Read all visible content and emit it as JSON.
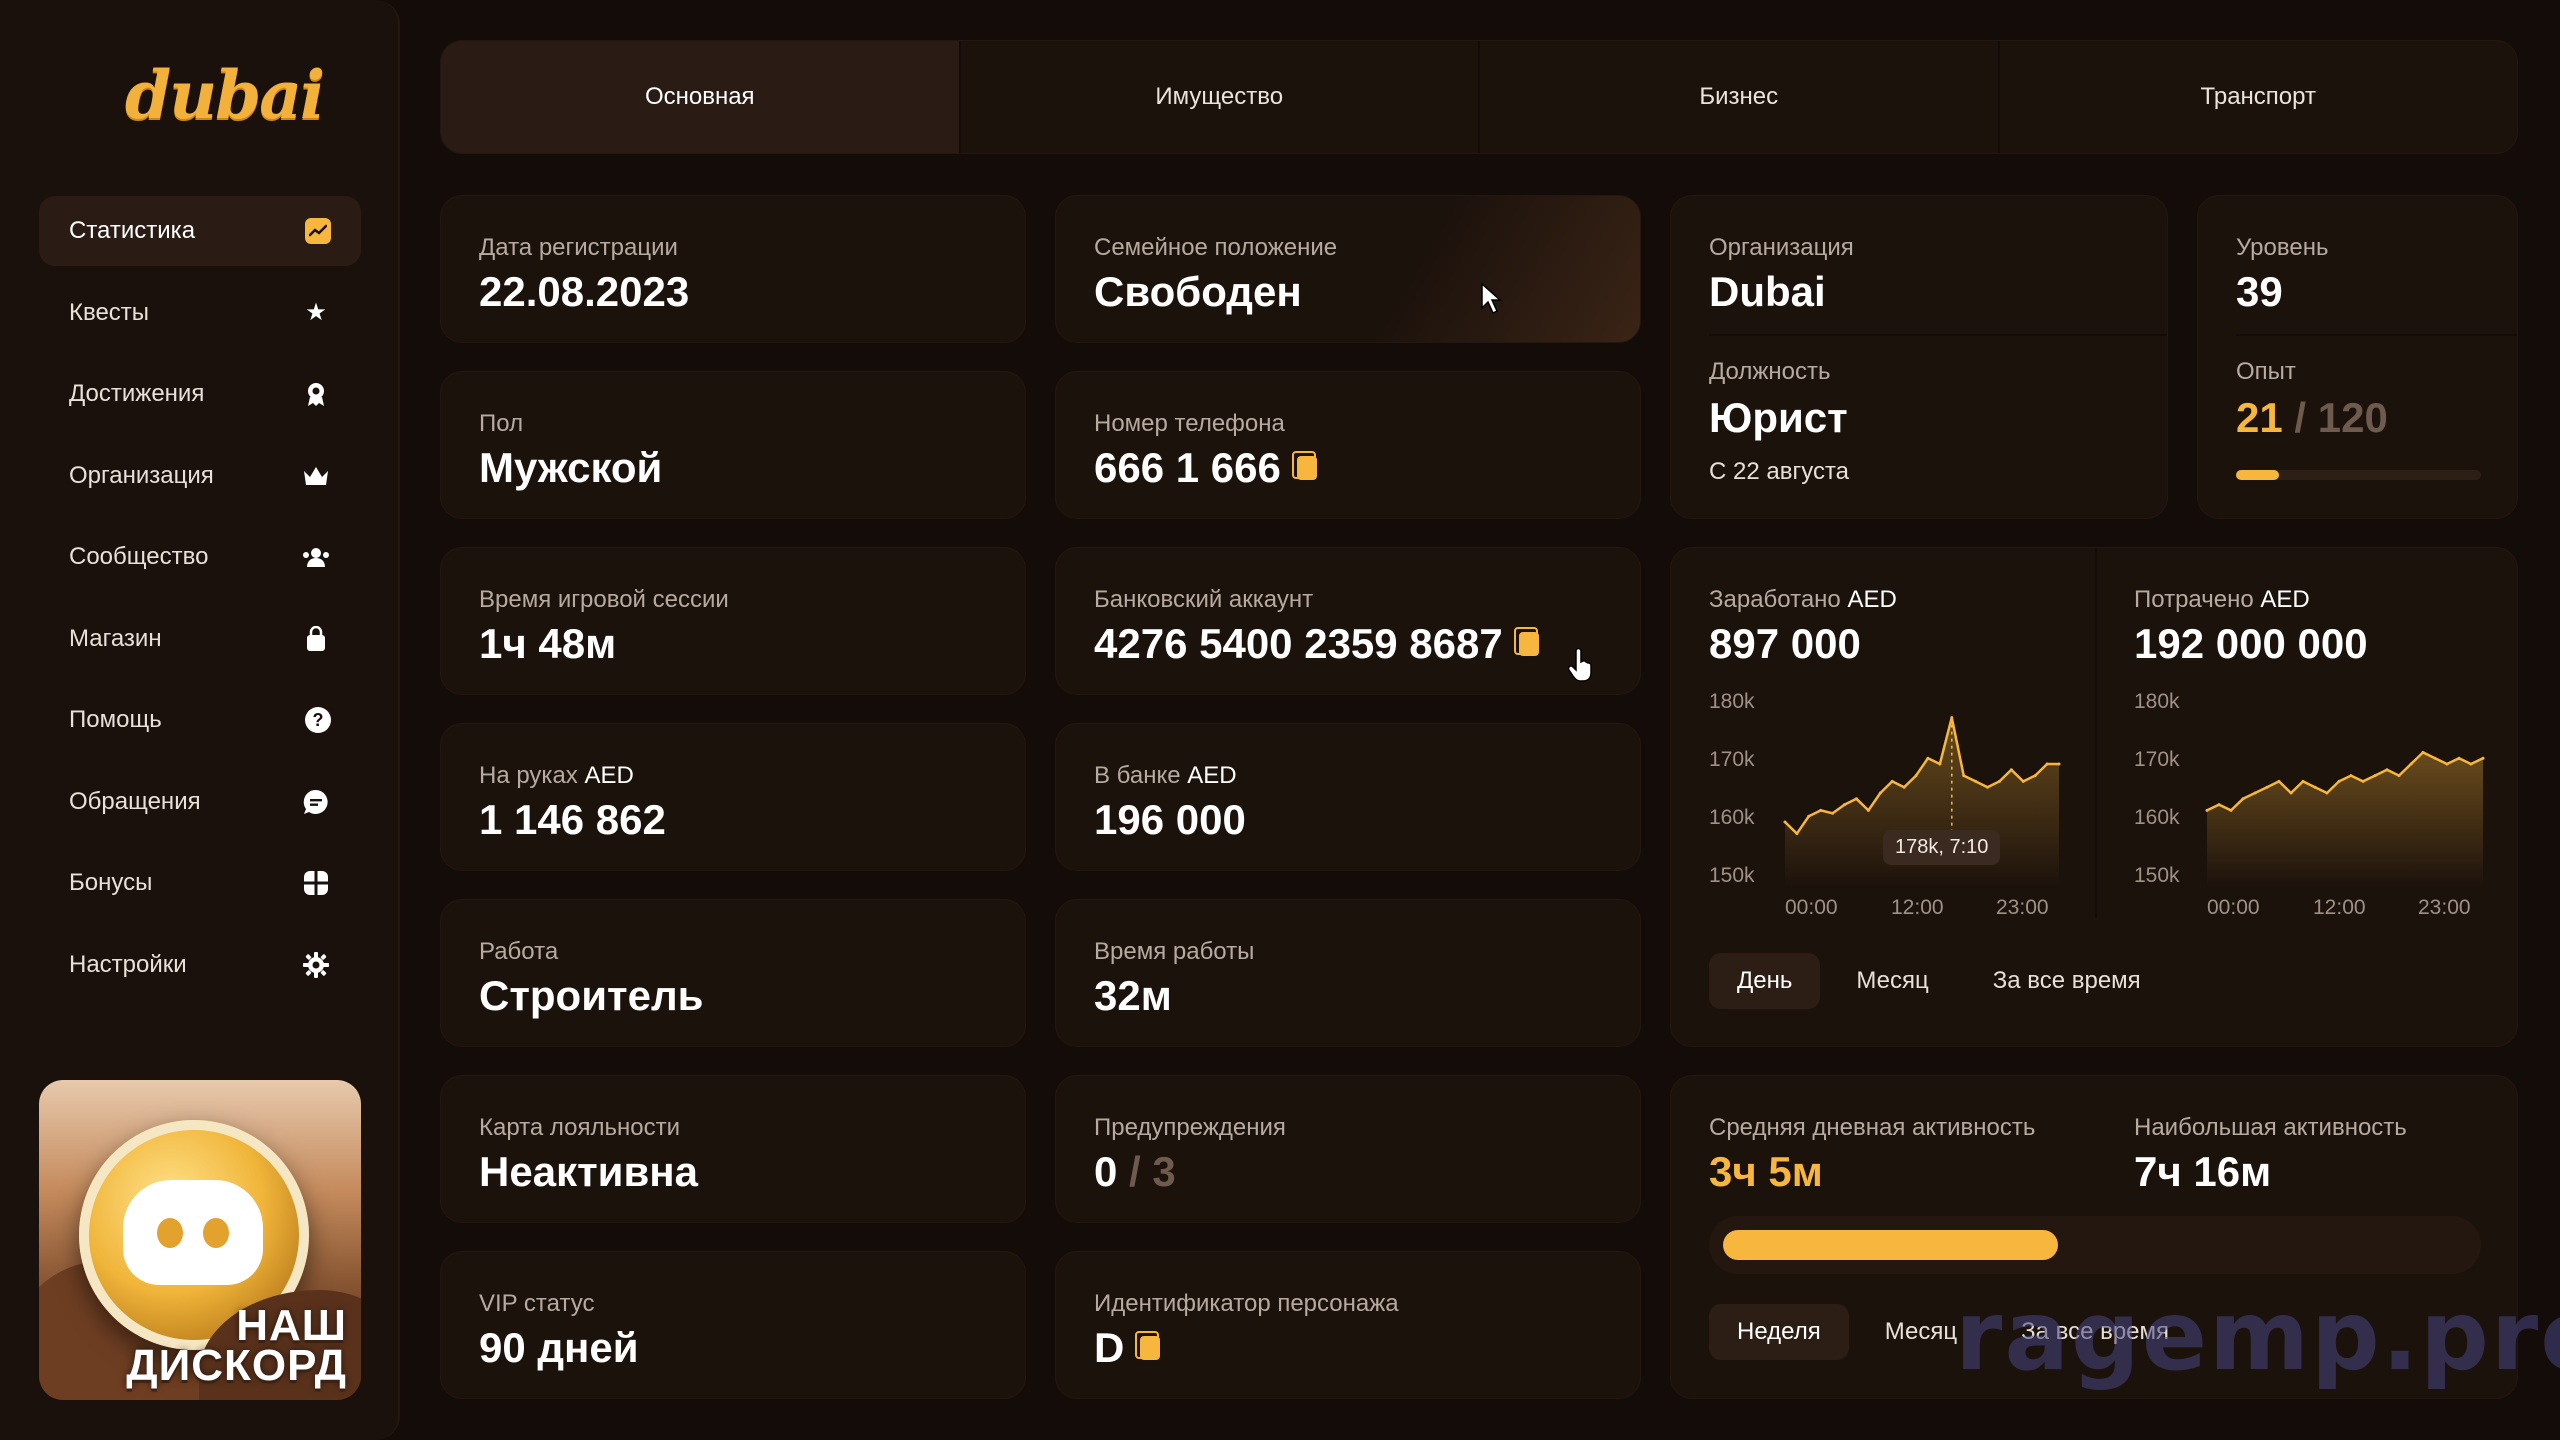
{
  "brand": "dubai",
  "sidebar": {
    "items": [
      {
        "label": "Статистика",
        "icon": "chart-icon"
      },
      {
        "label": "Квесты",
        "icon": "star-icon"
      },
      {
        "label": "Достижения",
        "icon": "award-icon"
      },
      {
        "label": "Организация",
        "icon": "crown-icon"
      },
      {
        "label": "Сообщество",
        "icon": "people-icon"
      },
      {
        "label": "Магазин",
        "icon": "bag-icon"
      },
      {
        "label": "Помощь",
        "icon": "question-icon"
      },
      {
        "label": "Обращения",
        "icon": "chat-icon"
      },
      {
        "label": "Бонусы",
        "icon": "gift-icon"
      },
      {
        "label": "Настройки",
        "icon": "gear-icon"
      }
    ],
    "active_index": 0,
    "discord_caption_1": "НАШ",
    "discord_caption_2": "ДИСКОРД"
  },
  "tabs": [
    "Основная",
    "Имущество",
    "Бизнес",
    "Транспорт"
  ],
  "active_tab": 0,
  "stats": {
    "reg_date": {
      "label": "Дата регистрации",
      "value": "22.08.2023"
    },
    "family": {
      "label": "Семейное положение",
      "value": "Свободен"
    },
    "gender": {
      "label": "Пол",
      "value": "Мужской"
    },
    "phone": {
      "label": "Номер телефона",
      "value": "666 1 666"
    },
    "session": {
      "label": "Время игровой сессии",
      "value": "1ч 48м"
    },
    "bank_account": {
      "label": "Банковский аккаунт",
      "value": "4276 5400 2359 8687"
    },
    "cash": {
      "label": "На руках",
      "unit": "AED",
      "value": "1 146 862"
    },
    "bank": {
      "label": "В банке",
      "unit": "AED",
      "value": "196 000"
    },
    "job": {
      "label": "Работа",
      "value": "Строитель"
    },
    "work_time": {
      "label": "Время работы",
      "value": "32м"
    },
    "loyalty": {
      "label": "Карта лояльности",
      "value": "Неактивна"
    },
    "warnings": {
      "label": "Предупреждения",
      "value": "0",
      "max": "/ 3"
    },
    "vip": {
      "label": "VIP статус",
      "value": "90 дней"
    },
    "char_id": {
      "label": "Идентификатор персонажа",
      "value": "D"
    }
  },
  "org": {
    "label": "Организация",
    "value": "Dubai",
    "position_label": "Должность",
    "position": "Юрист",
    "since": "С 22 августа"
  },
  "level": {
    "label": "Уровень",
    "value": "39",
    "xp_label": "Опыт",
    "xp": "21",
    "xp_max": "/ 120",
    "xp_fraction": 0.175
  },
  "money": {
    "earned_label": "Заработано",
    "earned_unit": "AED",
    "earned": "897 000",
    "spent_label": "Потрачено",
    "spent_unit": "AED",
    "spent": "192 000 000",
    "tooltip": "178k, 7:10",
    "periods": [
      "День",
      "Месяц",
      "За все время"
    ],
    "active_period": 0
  },
  "chart_data": [
    {
      "type": "line",
      "yticks": [
        "180k",
        "170k",
        "160k",
        "150k"
      ],
      "xticks": [
        "00:00",
        "12:00",
        "23:00"
      ],
      "ylim": [
        150,
        180
      ],
      "x": [
        0,
        1,
        2,
        3,
        4,
        5,
        6,
        7,
        8,
        9,
        10,
        11,
        12,
        13,
        14,
        15,
        16,
        17,
        18,
        19,
        20,
        21,
        22,
        23
      ],
      "values": [
        160,
        158,
        161,
        162,
        161.5,
        163,
        164,
        162,
        165,
        167,
        166,
        168,
        171,
        170,
        178,
        168,
        167,
        166,
        167,
        169,
        167,
        168,
        170,
        170
      ]
    },
    {
      "type": "line",
      "yticks": [
        "180k",
        "170k",
        "160k",
        "150k"
      ],
      "xticks": [
        "00:00",
        "12:00",
        "23:00"
      ],
      "ylim": [
        150,
        180
      ],
      "x": [
        0,
        1,
        2,
        3,
        4,
        5,
        6,
        7,
        8,
        9,
        10,
        11,
        12,
        13,
        14,
        15,
        16,
        17,
        18,
        19,
        20,
        21,
        22,
        23
      ],
      "values": [
        162,
        163,
        162,
        164,
        165,
        166,
        167,
        165,
        167,
        166,
        165,
        167,
        168,
        167,
        168,
        169,
        168,
        170,
        172,
        171,
        170,
        171,
        170,
        171
      ]
    }
  ],
  "activity": {
    "avg_label": "Средняя дневная активность",
    "avg": "3ч 5м",
    "max_label": "Наибольшая активность",
    "max": "7ч 16м",
    "fraction": 0.45,
    "periods": [
      "Неделя",
      "Месяц",
      "За все время"
    ],
    "active_period": 0
  },
  "watermark": "ragemp.pro",
  "colors": {
    "accent": "#f7b63d",
    "background": "#140c08",
    "card": "#1c120c"
  }
}
